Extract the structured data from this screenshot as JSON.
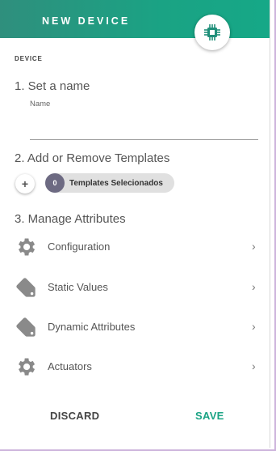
{
  "header": {
    "title": "NEW DEVICE",
    "badge_icon": "chip-icon",
    "accent": "#1aa384"
  },
  "section_label": "DEVICE",
  "step1": {
    "title": "1. Set a name",
    "name_label": "Name",
    "name_value": ""
  },
  "step2": {
    "title": "2. Add or Remove Templates",
    "add_icon": "plus-icon",
    "selected_count": "0",
    "selected_label": "Templates Selecionados"
  },
  "step3": {
    "title": "3. Manage Attributes",
    "items": [
      {
        "label": "Configuration",
        "icon": "gear-icon"
      },
      {
        "label": "Static Values",
        "icon": "tag-icon"
      },
      {
        "label": "Dynamic Attributes",
        "icon": "tag-icon"
      },
      {
        "label": "Actuators",
        "icon": "gear-icon"
      }
    ],
    "chevron": "›"
  },
  "actions": {
    "discard_label": "DISCARD",
    "save_label": "SAVE",
    "save_color": "#1aa384"
  }
}
